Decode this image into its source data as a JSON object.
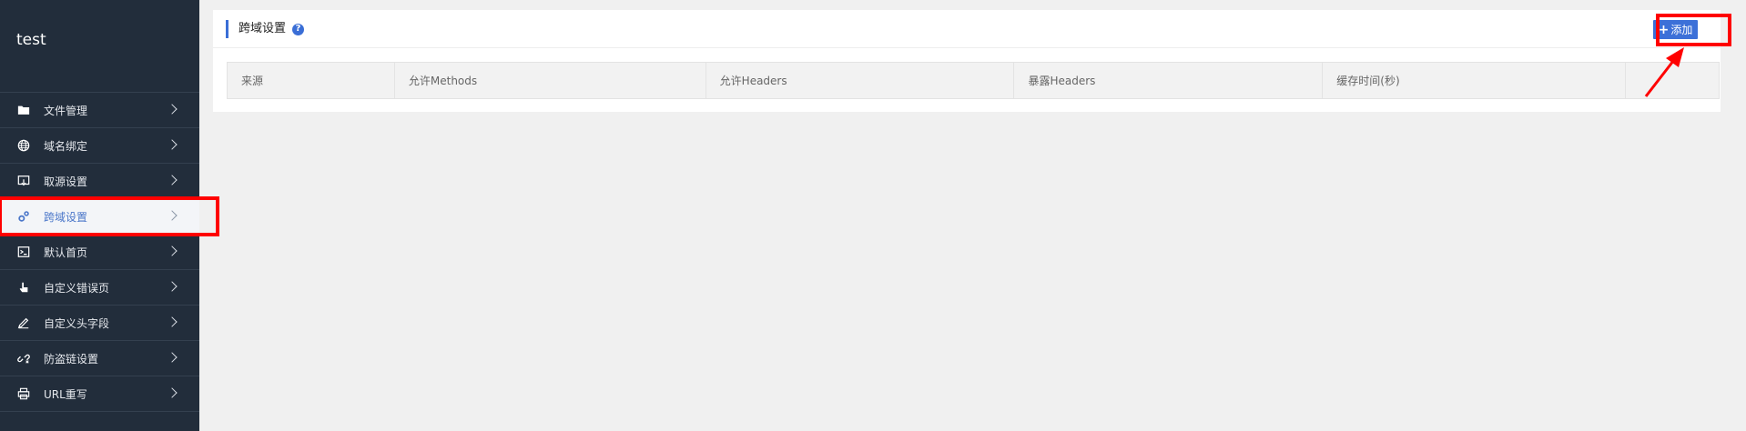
{
  "sidebar": {
    "title": "test",
    "items": [
      {
        "label": "文件管理",
        "icon": "folder-icon",
        "active": false
      },
      {
        "label": "域名绑定",
        "icon": "globe-icon",
        "active": false
      },
      {
        "label": "取源设置",
        "icon": "origin-icon",
        "active": false
      },
      {
        "label": "跨域设置",
        "icon": "gears-icon",
        "active": true
      },
      {
        "label": "默认首页",
        "icon": "terminal-icon",
        "active": false
      },
      {
        "label": "自定义错误页",
        "icon": "hand-pointer-icon",
        "active": false
      },
      {
        "label": "自定义头字段",
        "icon": "pencil-icon",
        "active": false
      },
      {
        "label": "防盗链设置",
        "icon": "link-icon",
        "active": false
      },
      {
        "label": "URL重写",
        "icon": "printer-icon",
        "active": false
      }
    ]
  },
  "panel": {
    "title": "跨域设置",
    "help_icon": "?",
    "add_label": "添加"
  },
  "table": {
    "columns": [
      "来源",
      "允许Methods",
      "允许Headers",
      "暴露Headers",
      "缓存时间(秒)",
      ""
    ]
  },
  "colors": {
    "sidebar_bg": "#222d3b",
    "accent": "#3c70d8",
    "highlight": "#ff0000"
  }
}
